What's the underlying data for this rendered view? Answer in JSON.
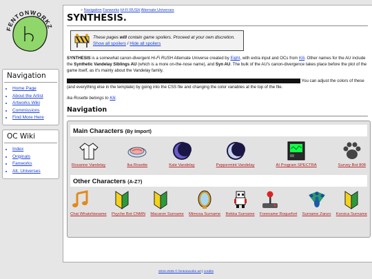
{
  "site_logo": {
    "text": "FENTONWORKZ"
  },
  "sidebar": {
    "nav": {
      "title": "Navigation",
      "items": [
        "Home Page",
        "About the Artist",
        "Artworks Wiki",
        "Commissions",
        "Find More Here"
      ]
    },
    "oc": {
      "title": "OC Wiki",
      "items": [
        "Index",
        "Originals",
        "Fanworks",
        "Alt. Universes"
      ]
    }
  },
  "breadcrumb": {
    "items": [
      "Navigation",
      "Fanworks",
      "Hi-Fi RUSH",
      "Alternate Universes"
    ],
    "sep": ">"
  },
  "page": {
    "title": "SYNTHESIS."
  },
  "spoiler": {
    "pre": "These pages ",
    "bold": "will",
    "post": " contain game spoilers. Proceed at your own discretion.",
    "show": "Show all spoilers",
    "slash": " / ",
    "hide": "Hide all spoilers"
  },
  "intro": {
    "t1": "SYNTHESIS",
    "t2": " is a somewhat canon-divergent ",
    "t3": "Hi-Fi RUSH",
    "t4": " Alternate Universe created by ",
    "link1": "Eight",
    "t5": ", with extra input and OCs from ",
    "link2": "Kili",
    "t6": ". Other names for the AU include the ",
    "t7": "Synthetic Vandelay Siblings AU",
    "t8": " (which is a more on-the-nose name), and ",
    "t9": "Syn AU",
    "t10": ". The bulk of the AU's canon-divergence takes place before the plot of the game itself, as it's mainly about the Vandelay family."
  },
  "css_note": {
    "text": " You can adjust the colors of these (and everything else in the template) by going into the CSS file and changing the color variables at the top of the file."
  },
  "ika_note": {
    "t1": "Ika Rosette belongs to ",
    "link": "Kili",
    "t2": "."
  },
  "nav_heading": "Navigation",
  "main_chars": {
    "title": "Main Characters",
    "sub": "(By Import)",
    "items": [
      {
        "name": "Roxanne Vandelay",
        "icon": "shirt-icon"
      },
      {
        "name": "Ika Rosette",
        "icon": "petri-dish-icon"
      },
      {
        "name": "Kale Vandelay",
        "icon": "moon-icon"
      },
      {
        "name": "Peppermint Vandelay",
        "icon": "moon-icon"
      },
      {
        "name": "AI Program SPECTRA",
        "icon": "monitor-icon"
      },
      {
        "name": "Survey Bot 808",
        "icon": "paw-icon"
      }
    ]
  },
  "other_chars": {
    "title": "Other Characters",
    "sub": "(A-Z?)",
    "items": [
      {
        "name": "Chai Whatshisname",
        "icon": "music-note-icon"
      },
      {
        "name": "Psyche Bot CNMN",
        "icon": "beginner-mark-icon"
      },
      {
        "name": "Macaron Surname",
        "icon": "beginner-mark-icon"
      },
      {
        "name": "Mimosa Surname",
        "icon": "mirror-icon"
      },
      {
        "name": "Rekka Surname",
        "icon": "pixel-sprite-icon"
      },
      {
        "name": "Forename Roquefort",
        "icon": "joystick-icon"
      },
      {
        "name": "Surname Zanzo",
        "icon": "peacock-icon"
      },
      {
        "name": "Korsica Surname",
        "icon": "beginner-mark-icon"
      }
    ]
  },
  "footer": {
    "text": "2024-2025 © fentonworks art",
    "sep": " | ",
    "link": "credits"
  },
  "colors": {
    "link": "#1a3fd6",
    "char_link": "#b01818",
    "background": "#e6e6e6"
  }
}
